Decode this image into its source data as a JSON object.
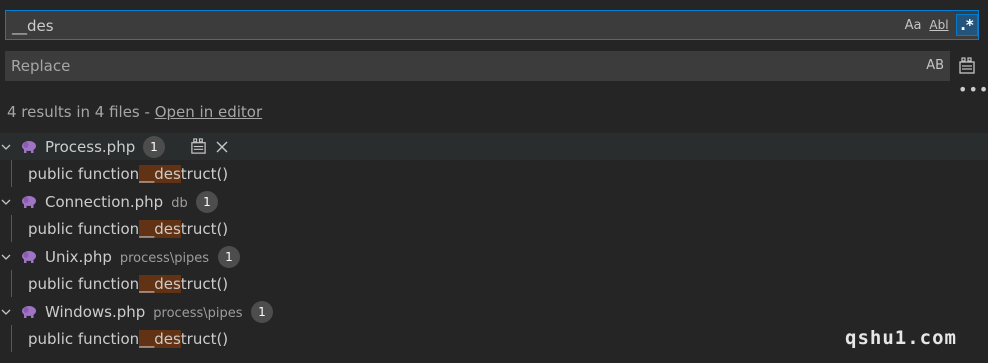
{
  "search": {
    "value": "__des"
  },
  "search_options": {
    "match_case": "Aa",
    "whole_word": "Abl",
    "regex": ".*"
  },
  "replace": {
    "placeholder": "Replace",
    "preserve_case": "AB"
  },
  "summary": {
    "text": "4 results in 4 files - ",
    "link": "Open in editor"
  },
  "results": [
    {
      "file": "Process.php",
      "path": "",
      "count": "1",
      "match_prefix": "public function ",
      "match_hl": "__des",
      "match_suffix": "truct()"
    },
    {
      "file": "Connection.php",
      "path": "db",
      "count": "1",
      "match_prefix": "public function ",
      "match_hl": "__des",
      "match_suffix": "truct()"
    },
    {
      "file": "Unix.php",
      "path": "process\\pipes",
      "count": "1",
      "match_prefix": "public function ",
      "match_hl": "__des",
      "match_suffix": "truct()"
    },
    {
      "file": "Windows.php",
      "path": "process\\pipes",
      "count": "1",
      "match_prefix": "public function ",
      "match_hl": "__des",
      "match_suffix": "truct()"
    }
  ],
  "watermark": "qshu1.com",
  "colors": {
    "accent": "#007fd4",
    "match_highlight": "#613214",
    "php_icon": "#a074c4"
  }
}
